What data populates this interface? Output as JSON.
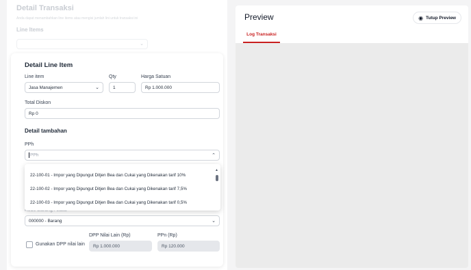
{
  "background": {
    "title": "Detail Transaksi",
    "subtitle": "Anda dapat menambahkan line items atau mengisi jumlah lini untuk transaksi ini",
    "section": "Line Items"
  },
  "line_item_card": {
    "title": "Detail Line Item",
    "line_item": {
      "label": "Line item",
      "value": "Jasa Manajemen"
    },
    "qty": {
      "label": "Qty",
      "value": "1"
    },
    "harga": {
      "label": "Harga Satuan",
      "value": "Rp 1.000.000"
    },
    "diskon": {
      "label": "Total Diskon",
      "value": "Rp 0"
    },
    "detail_tambahan": "Detail tambahan",
    "pph": {
      "label": "PPh",
      "placeholder": "PPh"
    },
    "kode_barang": {
      "label": "Kode Barang / Jasa",
      "value": "000000 - Barang"
    },
    "dpp_checkbox_label": "Gunakan DPP nilai lain",
    "dpp_nilai_lain": {
      "label": "DPP Nilai Lain (Rp)",
      "value": "Rp 1.000.000"
    },
    "ppn": {
      "label": "PPn (Rp)",
      "value": "Rp 120.000"
    }
  },
  "pph_dropdown": {
    "options": [
      "22-100-01 - Impor yang Dipungut Ditjen Bea dan Cukai yang Dikenakan tarif 10%",
      "22-100-02 - Impor yang Dipungut Ditjen Bea dan Cukai yang Dikenakan tarif 7,5%",
      "22-100-03 - Impor yang Dipungut Ditjen Bea dan Cukai yang Dikenakan tarif 0,5%"
    ]
  },
  "preview": {
    "title": "Preview",
    "close_label": "Tutup Preview",
    "tabs": [
      "Log Transaksi"
    ]
  },
  "colors": {
    "accent": "#c81e1e"
  }
}
